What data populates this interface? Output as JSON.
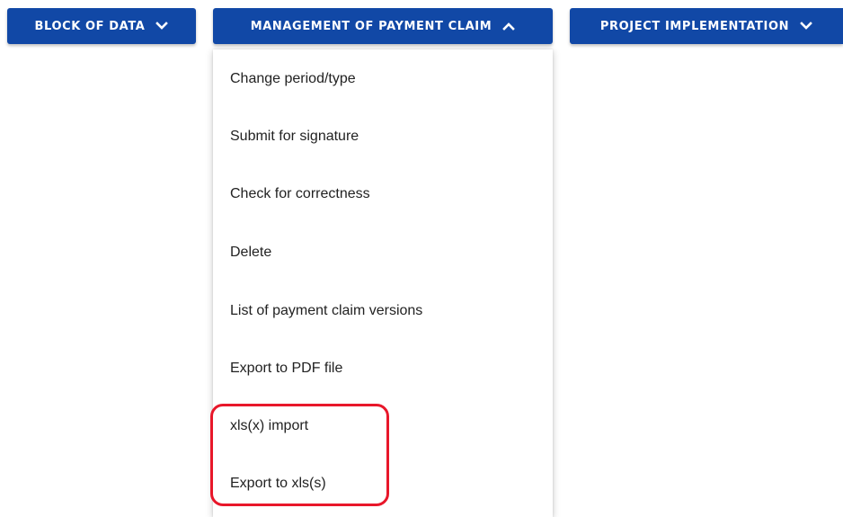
{
  "colors": {
    "button_bg": "#1148a6",
    "button_text": "#ffffff",
    "menu_text": "#222222",
    "highlight": "#e8172a"
  },
  "toolbar": {
    "block_of_data": {
      "label": "BLOCK OF DATA",
      "icon": "chevron-down-icon"
    },
    "management_of_payment_claim": {
      "label": "MANAGEMENT OF PAYMENT CLAIM",
      "icon": "chevron-up-icon",
      "expanded": true
    },
    "project_implementation": {
      "label": "PROJECT IMPLEMENTATION",
      "icon": "chevron-down-icon"
    }
  },
  "menu": {
    "items": [
      {
        "label": "Change period/type"
      },
      {
        "label": "Submit for signature"
      },
      {
        "label": "Check for correctness"
      },
      {
        "label": "Delete"
      },
      {
        "label": "List of payment claim versions"
      },
      {
        "label": "Export to PDF file"
      },
      {
        "label": "xls(x) import"
      },
      {
        "label": "Export to xls(s)"
      }
    ]
  }
}
